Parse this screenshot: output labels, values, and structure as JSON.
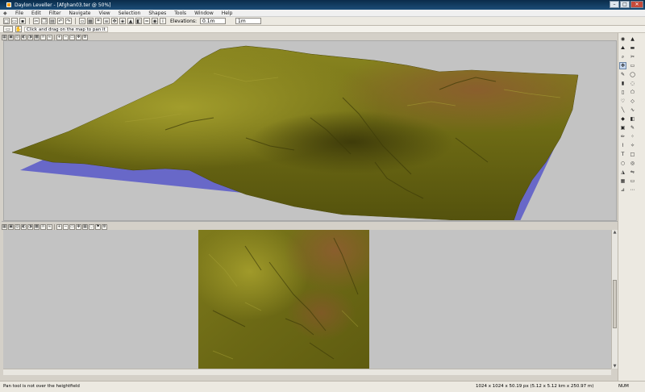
{
  "window": {
    "title": "Daylon Leveller - [Afghan03.ter @ 50%]",
    "minimize": "–",
    "maximize": "□",
    "close": "✕"
  },
  "menu": {
    "items": [
      "File",
      "Edit",
      "Filter",
      "Navigate",
      "View",
      "Selection",
      "Shapes",
      "Tools",
      "Window",
      "Help"
    ]
  },
  "toolbar": {
    "elevations_label": "Elevations:",
    "elevation_step": "0.1m",
    "elevation_unit": "1m"
  },
  "hint": {
    "text": "Click and drag on the map to pan it"
  },
  "colors": {
    "terrain_dark": "#5b5a10",
    "terrain_mid": "#7a7818",
    "terrain_light": "#9a9628",
    "terrain_peak": "#7c5a2a",
    "water": "#6868c8",
    "viewport_bg": "#c3c3c3"
  },
  "icons": {
    "right_tools": [
      "eye-icon",
      "terrain-icon",
      "mountain-icon",
      "zoom-icon",
      "scissors-icon",
      "pan-icon",
      "rect-select-icon",
      "ellipse-select-icon",
      "lasso-icon",
      "polygon-icon",
      "brush-icon",
      "eraser-icon",
      "dropper-icon",
      "fill-icon",
      "line-icon",
      "curve-icon",
      "rect-icon",
      "ellipse-icon",
      "star-icon",
      "text-icon",
      "gradient-icon",
      "contour-icon",
      "warp-icon",
      "grid-icon"
    ]
  },
  "status": {
    "left": "Pan tool is not over the heightfield",
    "right": "1024 x 1024 x 50.19 px (5.12 x 5.12 km x 250.97 m)",
    "num": "NUM"
  }
}
